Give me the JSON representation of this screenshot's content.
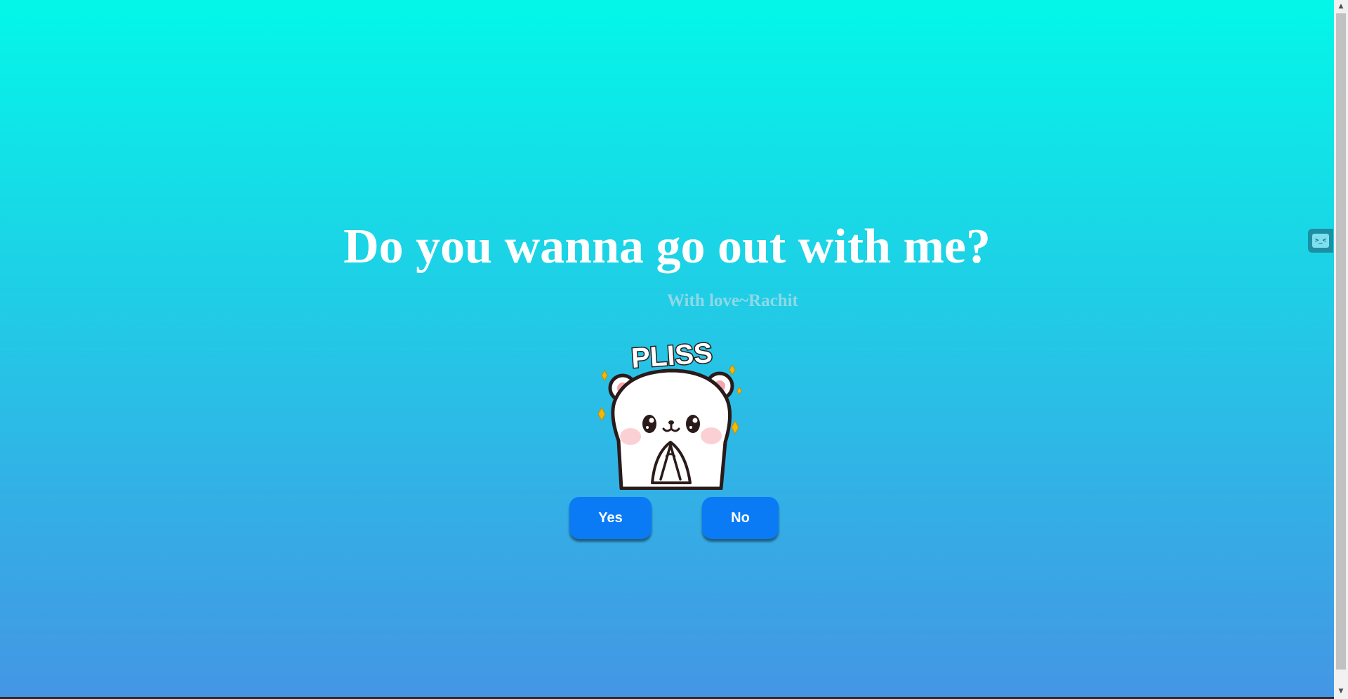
{
  "page": {
    "headline": "Do you wanna go out with me?",
    "signature": "With love~Rachit",
    "sticker": {
      "caption": "PLISS",
      "icon": "bear-begging-sticker"
    }
  },
  "buttons": {
    "yes_label": "Yes",
    "no_label": "No"
  },
  "side_widget": {
    "icon": "devtools-widget-icon",
    "glyph": ">_<"
  },
  "colors": {
    "gradient_top": "#03f7e9",
    "gradient_bottom": "#4496e4",
    "button": "#0a7bf5",
    "headline": "#ffffff",
    "signature": "#8fd9e6"
  }
}
